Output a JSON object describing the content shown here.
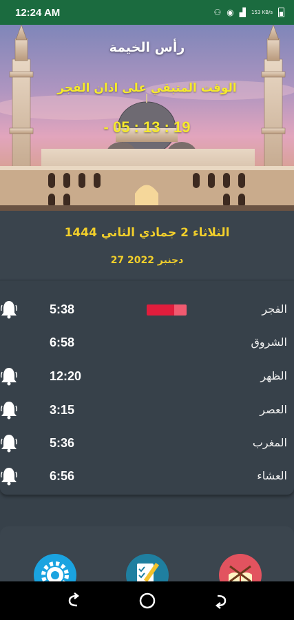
{
  "status_bar": {
    "time": "12:24 AM",
    "network_speed": "153 KB/s"
  },
  "header": {
    "city": "رأس الخيمة",
    "remaining_label": "الوقت المتبقي على اذان الفجر",
    "countdown": "- 05 : 13 : 19"
  },
  "date": {
    "hijri": "الثلاثاء  2  جمادي الثاني  1444",
    "gregorian": "27  دجنبر  2022"
  },
  "prayers": [
    {
      "name": "الفجر",
      "time": "5:38",
      "alarm": true,
      "next": true
    },
    {
      "name": "الشروق",
      "time": "6:58",
      "alarm": false,
      "next": false
    },
    {
      "name": "الظهر",
      "time": "12:20",
      "alarm": true,
      "next": false
    },
    {
      "name": "العصر",
      "time": "3:15",
      "alarm": true,
      "next": false
    },
    {
      "name": "المغرب",
      "time": "5:36",
      "alarm": true,
      "next": false
    },
    {
      "name": "العشاء",
      "time": "6:56",
      "alarm": true,
      "next": false
    }
  ],
  "bottom_buttons": [
    {
      "icon": "gear-icon"
    },
    {
      "icon": "checklist-pen-icon"
    },
    {
      "icon": "quran-book-icon"
    }
  ],
  "colors": {
    "status_bar": "#1b6b3f",
    "accent_yellow": "#f2cf2b",
    "next_prayer": "#e11d3c",
    "background": "#37414a"
  }
}
